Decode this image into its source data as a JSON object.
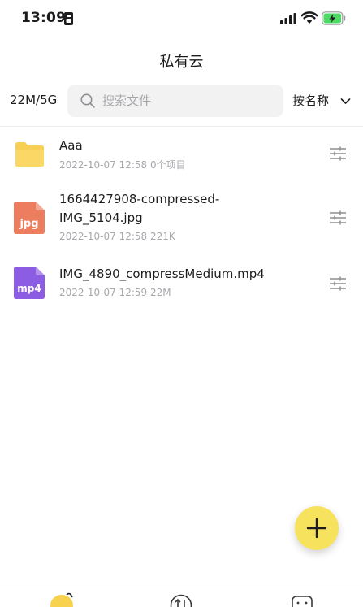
{
  "status_bar": {
    "time": "13:09"
  },
  "nav": {
    "title": "私有云"
  },
  "toolbar": {
    "storage_usage": "22M/5G",
    "search_placeholder": "搜索文件",
    "sort_label": "按名称"
  },
  "files": [
    {
      "name": "Aaa",
      "meta": "2022-10-07 12:58 0个项目",
      "kind": "folder-icon"
    },
    {
      "name_line1": "1664427908-compressed-",
      "name_line2": "IMG_5104.jpg",
      "meta": "2022-10-07 12:58 221K",
      "kind": "jpg-file-icon",
      "badge": "jpg"
    },
    {
      "name": "IMG_4890_compressMedium.mp4",
      "meta": "2022-10-07 12:59 22M",
      "kind": "mp4-file-icon",
      "badge": "mp4"
    }
  ],
  "icons": {
    "folder": "folder-icon",
    "jpg": "jpg-file-icon",
    "mp4": "mp4-file-icon",
    "settings": "sliders-icon",
    "add": "plus-icon",
    "search": "search-icon",
    "sort": "chevron-down-icon"
  },
  "colors": {
    "folder": "#f8cf55",
    "jpg": "#ec7d5e",
    "mp4": "#8c5de2",
    "fab": "#f7e25e",
    "battery": "#4cd964"
  }
}
